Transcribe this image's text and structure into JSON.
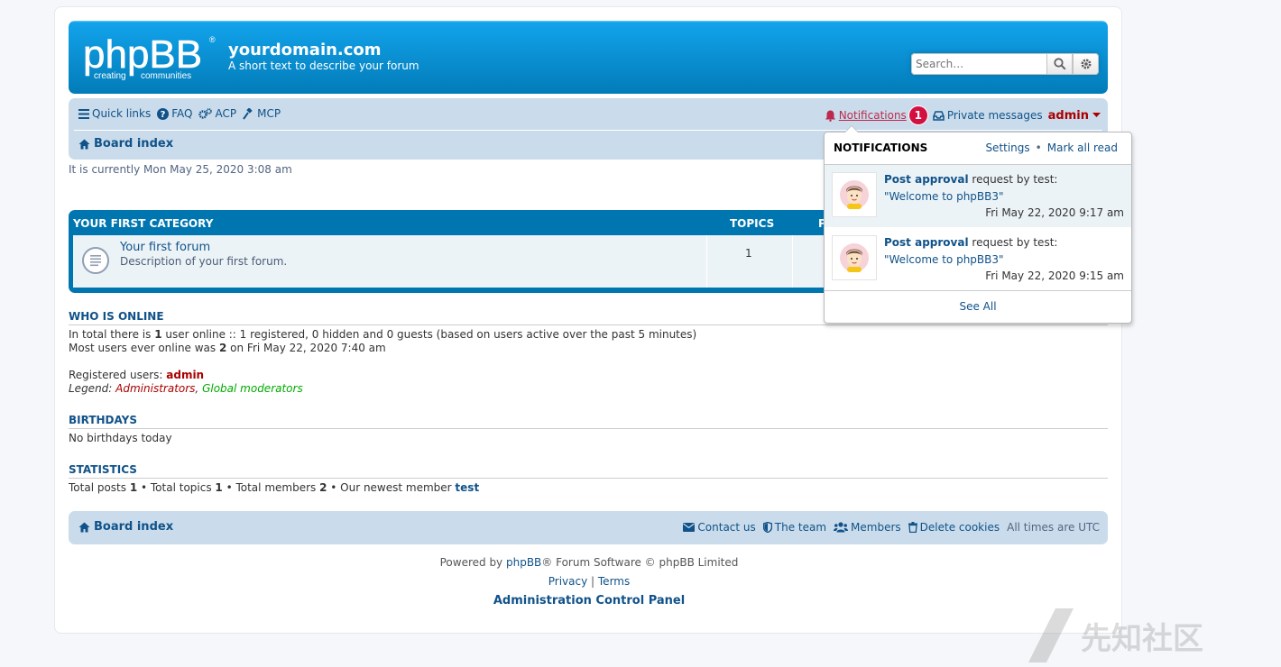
{
  "header": {
    "logo_main": "phpBB",
    "logo_sub_left": "creating",
    "logo_sub_right": "communities",
    "site_title": "yourdomain.com",
    "site_description": "A short text to describe your forum",
    "search_placeholder": "Search…"
  },
  "navbar": {
    "quick_links": "Quick links",
    "faq": "FAQ",
    "acp": "ACP",
    "mcp": "MCP",
    "notifications": "Notifications",
    "notifications_count": "1",
    "private_messages": "Private messages",
    "username": "admin",
    "board_index": "Board index"
  },
  "current_time": "It is currently Mon May 25, 2020 3:08 am",
  "forum_table": {
    "category": "YOUR FIRST CATEGORY",
    "col_topics": "TOPICS",
    "col_posts": "P",
    "forum": {
      "title": "Your first forum",
      "description": "Description of your first forum.",
      "topics": "1"
    }
  },
  "who_is_online": {
    "heading": "WHO IS ONLINE",
    "line1_prefix": "In total there is ",
    "line1_count": "1",
    "line1_suffix": " user online :: 1 registered, 0 hidden and 0 guests (based on users active over the past 5 minutes)",
    "line2_prefix": "Most users ever online was ",
    "line2_count": "2",
    "line2_suffix": " on Fri May 22, 2020 7:40 am",
    "registered_label": "Registered users: ",
    "registered_user": "admin",
    "legend_label": "Legend: ",
    "legend_admins": "Administrators",
    "legend_sep": ", ",
    "legend_gmods": "Global moderators"
  },
  "birthdays": {
    "heading": "BIRTHDAYS",
    "text": "No birthdays today"
  },
  "statistics": {
    "heading": "STATISTICS",
    "posts_label": "Total posts ",
    "posts": "1",
    "topics_label": " • Total topics ",
    "topics": "1",
    "members_label": " • Total members ",
    "members": "2",
    "newest_label": " • Our newest member ",
    "newest": "test"
  },
  "footer_nav": {
    "board_index": "Board index",
    "contact": "Contact us",
    "team": "The team",
    "members": "Members",
    "delete_cookies": "Delete cookies",
    "timezone": "All times are UTC"
  },
  "copyright": {
    "powered_prefix": "Powered by ",
    "phpbb": "phpBB",
    "powered_suffix": "® Forum Software © phpBB Limited",
    "privacy": "Privacy",
    "sep": " | ",
    "terms": "Terms",
    "acp": "Administration Control Panel"
  },
  "notifications_dropdown": {
    "title": "NOTIFICATIONS",
    "settings": "Settings",
    "bullet": "•",
    "mark_all_read": "Mark all read",
    "items": [
      {
        "type": "Post approval",
        "by": " request by test:",
        "topic": "\"Welcome to phpBB3\"",
        "date": "Fri May 22, 2020 9:17 am"
      },
      {
        "type": "Post approval",
        "by": " request by test:",
        "topic": "\"Welcome to phpBB3\"",
        "date": "Fri May 22, 2020 9:15 am"
      }
    ],
    "see_all": "See All"
  },
  "watermark_text": "先知社区",
  "colors": {
    "header_blue": "#0076b1",
    "nav_bg": "#cadceb",
    "admin_red": "#aa0000",
    "badge_red": "#d31141",
    "link_blue": "#105289"
  }
}
